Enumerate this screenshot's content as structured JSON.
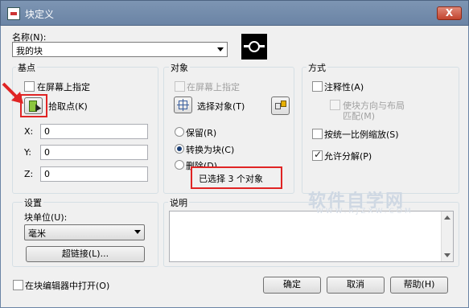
{
  "window": {
    "title": "块定义",
    "close_label": "X"
  },
  "name": {
    "label": "名称(N):",
    "value": "我的块"
  },
  "base_point": {
    "title": "基点",
    "specify_on_screen": "在屏幕上指定",
    "pick_point": "拾取点(K)",
    "x_label": "X:",
    "x_value": "0",
    "y_label": "Y:",
    "y_value": "0",
    "z_label": "Z:",
    "z_value": "0"
  },
  "objects": {
    "title": "对象",
    "specify_on_screen": "在屏幕上指定",
    "select_objects": "选择对象(T)",
    "retain": "保留(R)",
    "convert_to_block": "转换为块(C)",
    "delete": "删除(D)",
    "selected_count": "已选择 3 个对象"
  },
  "behavior": {
    "title": "方式",
    "annotative": "注释性(A)",
    "match_orientation_line1": "使块方向与布局",
    "match_orientation_line2": "匹配(M)",
    "scale_uniformly": "按统一比例缩放(S)",
    "allow_exploding": "允许分解(P)",
    "allow_exploding_checked": true
  },
  "settings": {
    "title": "设置",
    "block_unit_label": "块单位(U):",
    "block_unit_value": "毫米",
    "hyperlink_button": "超链接(L)..."
  },
  "description": {
    "title": "说明"
  },
  "footer": {
    "open_in_editor": "在块编辑器中打开(O)",
    "ok": "确定",
    "cancel": "取消",
    "help": "帮助(H)"
  },
  "watermark": {
    "main": "软件自学网",
    "sub": "WWW.RJZXW.COM"
  },
  "colors": {
    "titlebar": "#6b84a5",
    "highlight": "#e02424",
    "dialog_bg": "#f0f0f0"
  }
}
